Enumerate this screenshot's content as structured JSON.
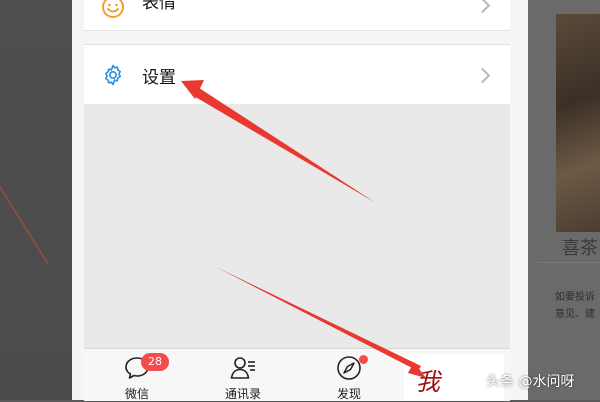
{
  "background_right": {
    "caption": "喜茶",
    "meta_line1": "如要投诉",
    "meta_line2": "意见、建"
  },
  "menu": {
    "emoji_label": "表情",
    "settings_label": "设置"
  },
  "tabbar": {
    "chat_label": "微信",
    "chat_badge": "28",
    "contacts_label": "通讯录",
    "discover_label": "发现",
    "me_label": "我"
  },
  "watermark": "头条 @水问呀",
  "colors": {
    "accent_blue": "#2b8de0",
    "emoji_orange": "#f0a030",
    "badge_red": "#f24c4c",
    "arrow_red": "#e8382f"
  },
  "icons": {
    "emoji": "smiley-face-icon",
    "settings": "gear-icon",
    "chat": "chat-bubble-icon",
    "contacts": "contacts-icon",
    "discover": "compass-icon",
    "chevron": "chevron-right-icon"
  }
}
